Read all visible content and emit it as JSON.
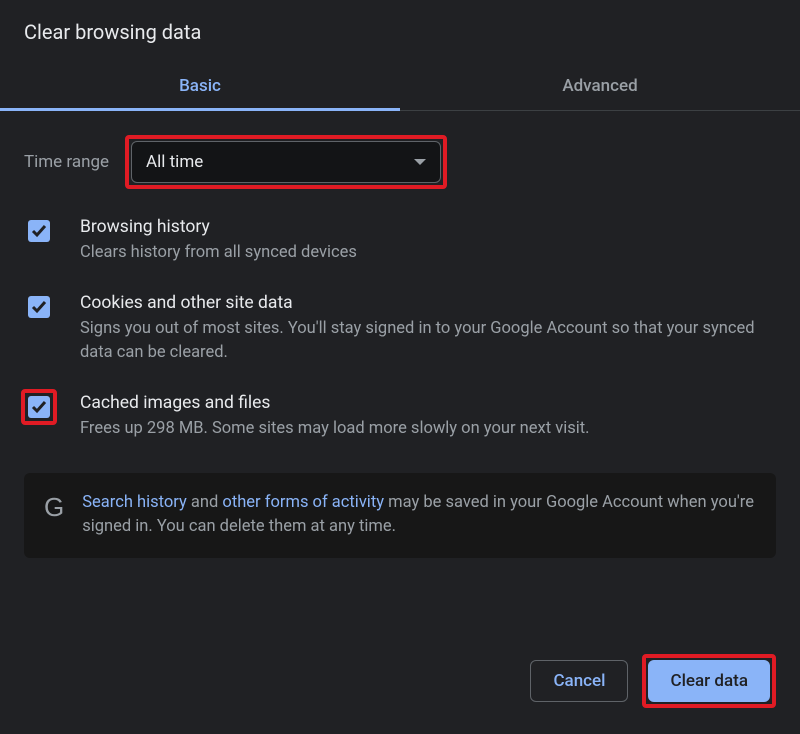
{
  "title": "Clear browsing data",
  "tabs": {
    "basic": "Basic",
    "advanced": "Advanced"
  },
  "time_range": {
    "label": "Time range",
    "selected": "All time"
  },
  "options": {
    "browsing_history": {
      "title": "Browsing history",
      "description": "Clears history from all synced devices"
    },
    "cookies": {
      "title": "Cookies and other site data",
      "description": "Signs you out of most sites. You'll stay signed in to your Google Account so that your synced data can be cleared."
    },
    "cache": {
      "title": "Cached images and files",
      "description": "Frees up 298 MB. Some sites may load more slowly on your next visit."
    }
  },
  "notice": {
    "prefix": "",
    "link1": "Search history",
    "mid1": " and ",
    "link2": "other forms of activity",
    "suffix": " may be saved in your Google Account when you're signed in. You can delete them at any time."
  },
  "buttons": {
    "cancel": "Cancel",
    "clear": "Clear data"
  }
}
